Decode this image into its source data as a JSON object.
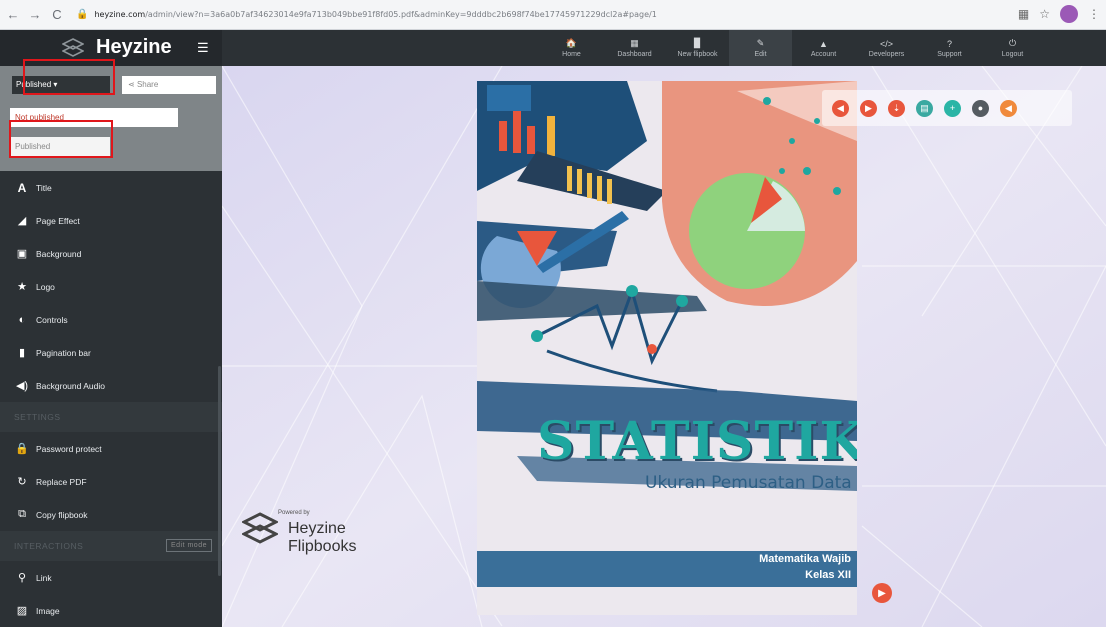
{
  "browser": {
    "url_host": "heyzine.com",
    "url_rest": "/admin/view?n=3a6a0b7af34623014e9fa713b049bbe91f8fd05.pdf&adminKey=9dddbc2b698f74be17745971229dcl2a#page/1"
  },
  "app": {
    "brand": "Heyzine"
  },
  "nav": [
    {
      "label": "Home",
      "icon": "🏠"
    },
    {
      "label": "Dashboard",
      "icon": "▦"
    },
    {
      "label": "New flipbook",
      "icon": "▉"
    },
    {
      "label": "Edit",
      "icon": "✎"
    },
    {
      "label": "Account",
      "icon": "▲"
    },
    {
      "label": "Developers",
      "icon": "</>"
    },
    {
      "label": "Support",
      "icon": "?"
    },
    {
      "label": "Logout",
      "icon": "⏻"
    }
  ],
  "publish": {
    "button_label": "Published ▾",
    "share_label": "Share",
    "options": [
      "Not published",
      "Published"
    ]
  },
  "sidebar": {
    "items": [
      {
        "label": "Title",
        "icon": "A"
      },
      {
        "label": "Page Effect",
        "icon": "◢"
      },
      {
        "label": "Background",
        "icon": "▣"
      },
      {
        "label": "Logo",
        "icon": "★"
      },
      {
        "label": "Controls",
        "icon": "◐"
      },
      {
        "label": "Pagination bar",
        "icon": "▮"
      },
      {
        "label": "Background Audio",
        "icon": "◀)"
      }
    ],
    "section_settings": "SETTINGS",
    "settings_items": [
      {
        "label": "Password protect",
        "icon": "🔒"
      },
      {
        "label": "Replace PDF",
        "icon": "↻"
      },
      {
        "label": "Copy flipbook",
        "icon": "⧉"
      }
    ],
    "section_interactions": "INTERACTIONS",
    "edit_mode": "Edit mode",
    "interaction_items": [
      {
        "label": "Link",
        "icon": "⚲"
      },
      {
        "label": "Image",
        "icon": "▨"
      }
    ]
  },
  "powered": {
    "label": "Powered by",
    "name_line1": "Heyzine",
    "name_line2": "Flipbooks"
  },
  "book": {
    "title": "STATISTIKA",
    "subtitle": "Ukuran Pemusatan Data",
    "line1": "Matematika Wajib",
    "line2": "Kelas XII"
  },
  "toolbar": [
    {
      "name": "previous-icon",
      "glyph": "◀",
      "color": "#e8563c"
    },
    {
      "name": "next-icon",
      "glyph": "▶",
      "color": "#e8563c"
    },
    {
      "name": "download-icon",
      "glyph": "⇣",
      "color": "#e8563c"
    },
    {
      "name": "print-icon",
      "glyph": "▤",
      "color": "#3aa9a1"
    },
    {
      "name": "zoom-icon",
      "glyph": "+",
      "color": "#2bb5a6"
    },
    {
      "name": "fullscreen-icon",
      "glyph": "●",
      "color": "#555b61"
    },
    {
      "name": "sound-icon",
      "glyph": "◀",
      "color": "#f08a3c"
    }
  ],
  "colors": {
    "accent": "#e8563c",
    "teal": "#1fa7a0",
    "navy": "#3a6f99",
    "sidebar": "#2c3135"
  }
}
